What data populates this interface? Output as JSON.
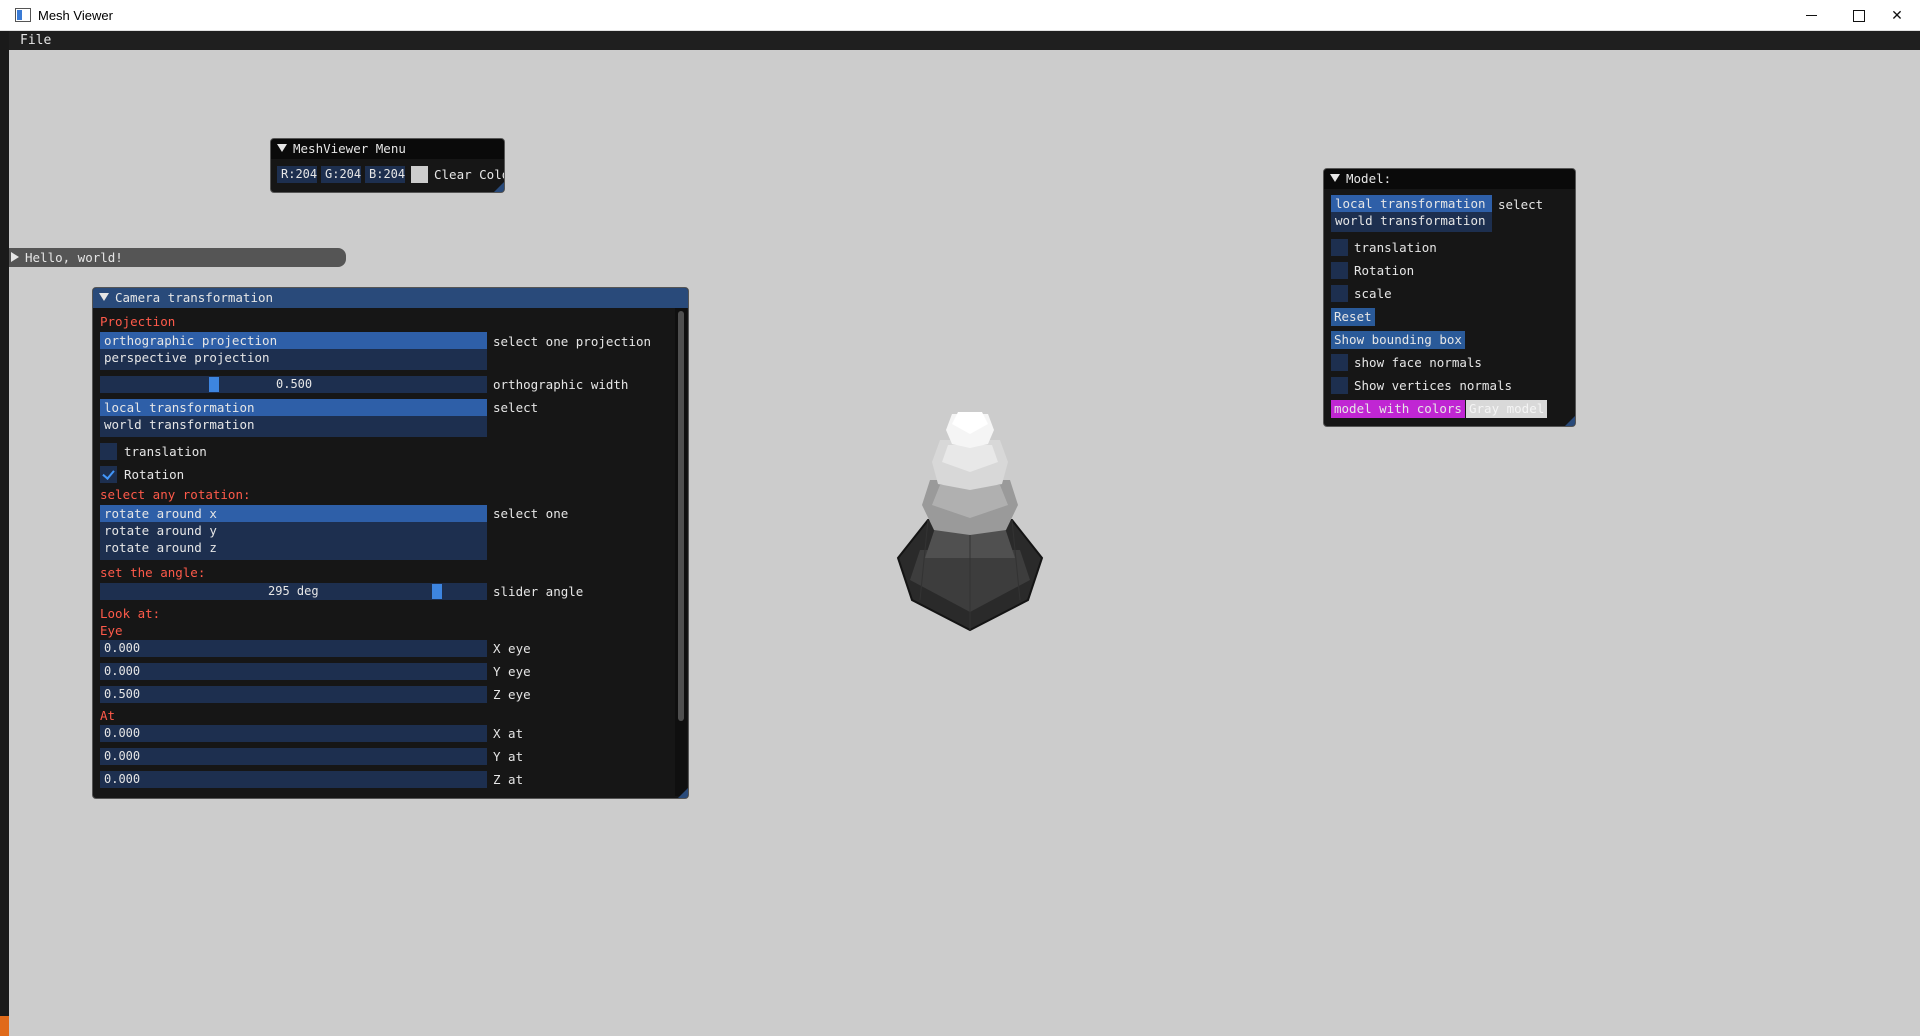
{
  "window": {
    "title": "Mesh Viewer"
  },
  "menubar": {
    "file": "File"
  },
  "meshviewer_menu": {
    "title": "MeshViewer Menu",
    "r": "R:204",
    "g": "G:204",
    "b": "B:204",
    "swatch_color": "#cccccc",
    "clear_label": "Clear Colo"
  },
  "hello": {
    "title": "Hello, world!"
  },
  "camera": {
    "title": "Camera transformation",
    "projection_header": "Projection",
    "projection_options": [
      "orthographic projection",
      "perspective projection"
    ],
    "projection_selected": 0,
    "projection_label": "select one projection",
    "ortho_value": "0.500",
    "ortho_fraction": 0.29,
    "ortho_label": "orthographic width",
    "transform_options": [
      "local transformation",
      "world transformation"
    ],
    "transform_label": "select",
    "translation_label": "translation",
    "translation_checked": false,
    "rotation_label": "Rotation",
    "rotation_checked": true,
    "rotation_header": "select any rotation:",
    "rotation_options": [
      "rotate around x",
      "rotate around y",
      "rotate around z"
    ],
    "rotation_select_label": "select one",
    "angle_header": "set the angle:",
    "angle_value": "295 deg",
    "angle_fraction": 0.88,
    "angle_label": "slider angle",
    "lookat_header": "Look at:",
    "eye_header": "Eye",
    "eye": [
      {
        "value": "0.000",
        "label": "X eye"
      },
      {
        "value": "0.000",
        "label": "Y eye"
      },
      {
        "value": "0.500",
        "label": "Z eye"
      }
    ],
    "at_header": "At",
    "at": [
      {
        "value": "0.000",
        "label": "X at"
      },
      {
        "value": "0.000",
        "label": "Y at"
      },
      {
        "value": "0.000",
        "label": "Z at"
      }
    ]
  },
  "model": {
    "title": "Model:",
    "transform_options": [
      "local transformation",
      "world transformation"
    ],
    "transform_label": "select",
    "translation_label": "translation",
    "rotation_label": "Rotation",
    "scale_label": "scale",
    "reset_label": "Reset",
    "bbox_label": "Show bounding box",
    "face_normals_label": "show face normals",
    "vertex_normals_label": "Show vertices normals",
    "colors_label": "model with colors",
    "gray_label": "Gray model"
  },
  "colors": {
    "background": "#cccccc",
    "accent": "#2e5fa8",
    "header_active": "#294a7a",
    "section_text": "#ff5a4a",
    "colors_button": "#c026d3"
  }
}
